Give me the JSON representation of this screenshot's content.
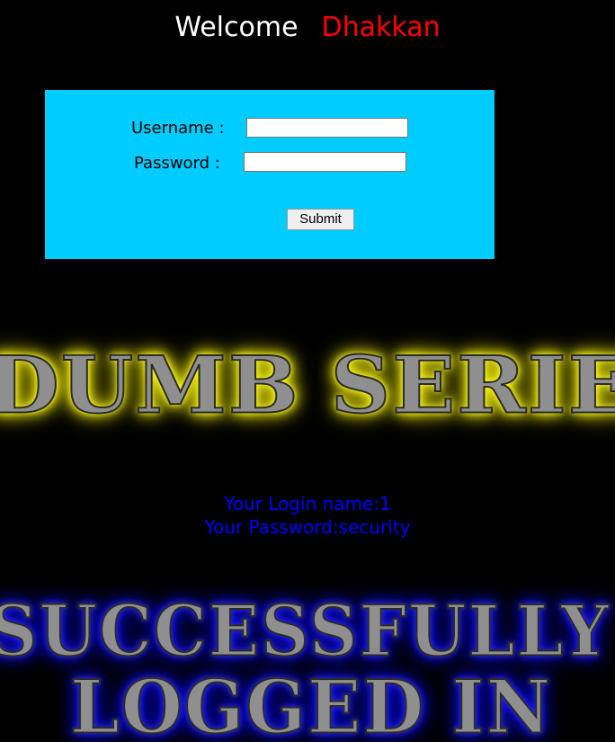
{
  "header": {
    "welcome_text": "Welcome",
    "name_text": "Dhakkan",
    "welcome_color": "#ffffff",
    "name_color": "#ff0000"
  },
  "login_form": {
    "background_color": "#00ccff",
    "username_label": "Username :",
    "username_value": "",
    "password_label": "Password :",
    "password_value": "",
    "submit_label": "Submit"
  },
  "banners": {
    "top_text": "DUMB SERIES",
    "top_glow_color": "#ffff00",
    "bottom_line1": "SUCCESSFULLY",
    "bottom_line2": "LOGGED IN",
    "bottom_glow_color": "#0000ff"
  },
  "result": {
    "login_line": "Your Login name:1",
    "password_line": "Your Password:security",
    "color": "#0000ff"
  }
}
